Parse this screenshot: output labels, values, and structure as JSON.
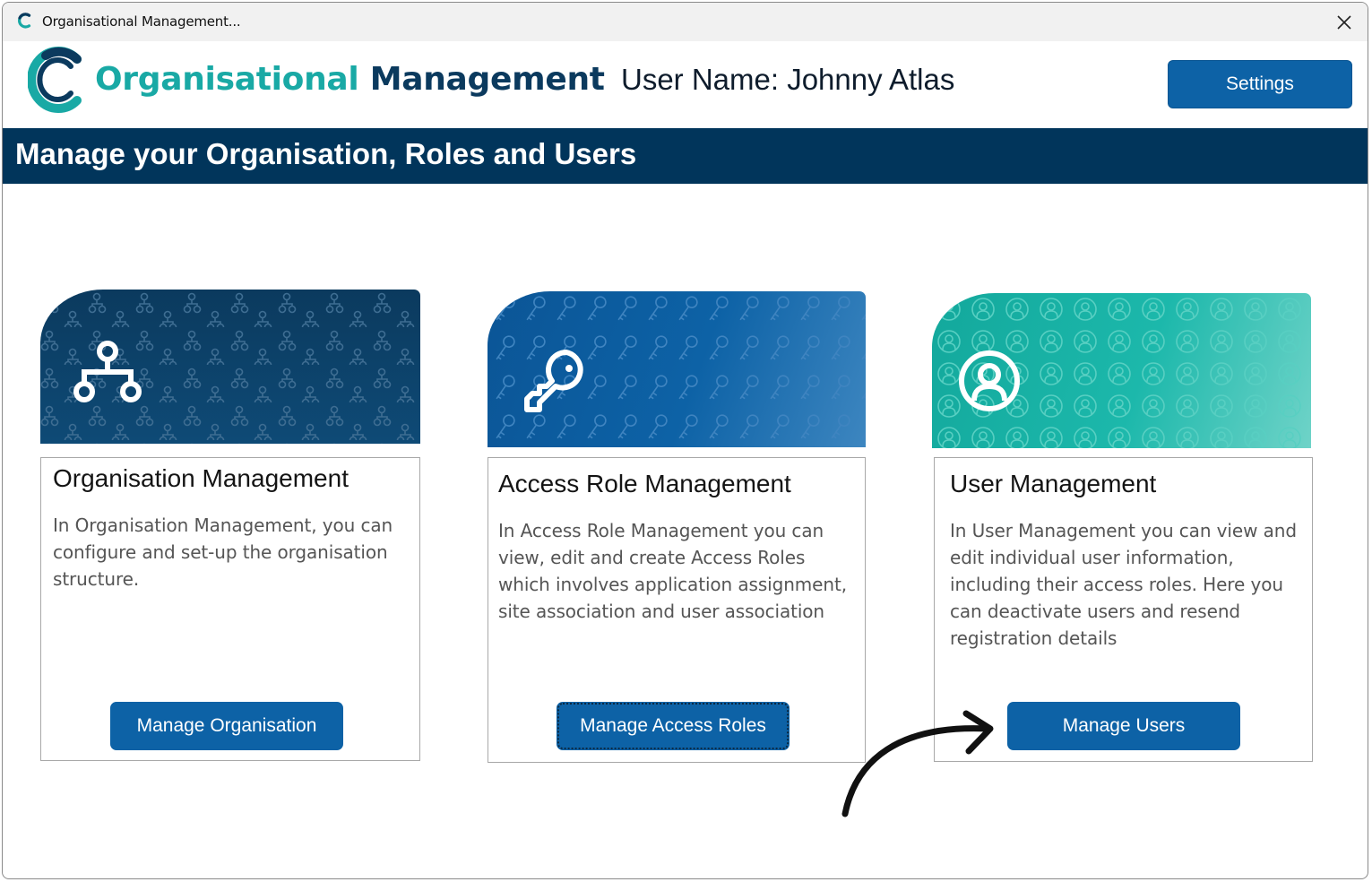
{
  "window": {
    "title": "Organisational Management...",
    "app_icon": "c-logo-icon",
    "close_icon": "close-icon"
  },
  "header": {
    "brand_part1": "Organisational",
    "brand_part2": "Management",
    "user_name": "User Name: Johnny Atlas",
    "settings_label": "Settings"
  },
  "banner": {
    "text": "Manage your Organisation, Roles and Users"
  },
  "cards": [
    {
      "icon": "hierarchy-icon",
      "title": "Organisation Management",
      "description_lines": [
        "In Organisation Management, you can",
        "configure and set-up the organisation",
        "structure."
      ],
      "button_label": "Manage Organisation",
      "header_color": "#0b3a5e"
    },
    {
      "icon": "key-icon",
      "title": "Access Role Management",
      "description_lines": [
        "In Access Role Management you can",
        "view, edit and create Access Roles",
        "which involves application assignment,",
        "site association and user association"
      ],
      "button_label": "Manage Access Roles",
      "header_color": "#0d62a6"
    },
    {
      "icon": "user-circle-icon",
      "title": "User Management",
      "description_lines": [
        "In User Management you can view and",
        "edit  individual user information,",
        "including their access roles. Here you",
        "can deactivate users and resend",
        "registration details"
      ],
      "button_label": "Manage Users",
      "header_color": "#19b3a8"
    }
  ],
  "colors": {
    "brand_teal": "#19a9a5",
    "brand_navy": "#0b3a5e",
    "banner": "#01355b",
    "button": "#0d62a6"
  }
}
